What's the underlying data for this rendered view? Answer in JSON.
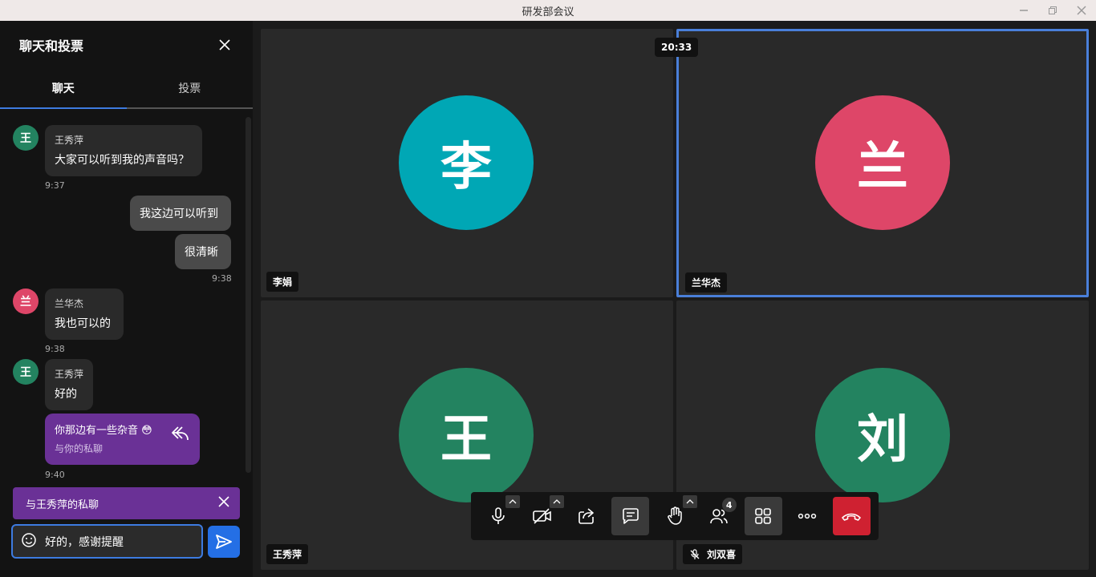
{
  "window": {
    "title": "研发部会议"
  },
  "sidebar": {
    "title": "聊天和投票",
    "tabs": [
      {
        "label": "聊天"
      },
      {
        "label": "投票"
      }
    ],
    "messages": [
      {
        "avatar": "王",
        "avatar_color": "#238360",
        "name": "王秀萍",
        "text": "大家可以听到我的声音吗？",
        "time": "9:37"
      },
      {
        "text": "我这边可以听到"
      },
      {
        "text": "很清晰",
        "time": "9:38"
      },
      {
        "avatar": "兰",
        "avatar_color": "#de4668",
        "name": "兰华杰",
        "text": "我也可以的",
        "time": "9:38"
      },
      {
        "avatar": "王",
        "avatar_color": "#238360",
        "name": "王秀萍",
        "text": "好的"
      },
      {
        "text": "你那边有一些杂音 😳",
        "sub": "与你的私聊",
        "time": "9:40"
      }
    ],
    "private_bar": {
      "label": "与王秀萍的私聊"
    },
    "input": {
      "value": "好的，感谢提醒",
      "placeholder": ""
    }
  },
  "tiles": [
    {
      "initial": "李",
      "color": "#00a7b5",
      "name": "李娟"
    },
    {
      "initial": "兰",
      "color": "#de4668",
      "name": "兰华杰"
    },
    {
      "initial": "王",
      "color": "#238360",
      "name": "王秀萍"
    },
    {
      "initial": "刘",
      "color": "#238360",
      "name": "刘双喜"
    }
  ],
  "timer": "20:33",
  "toolbar": {
    "participants_count": "4"
  },
  "colors": {
    "accent": "#3d7be0",
    "private": "#6a3196",
    "hangup": "#cf2131"
  }
}
